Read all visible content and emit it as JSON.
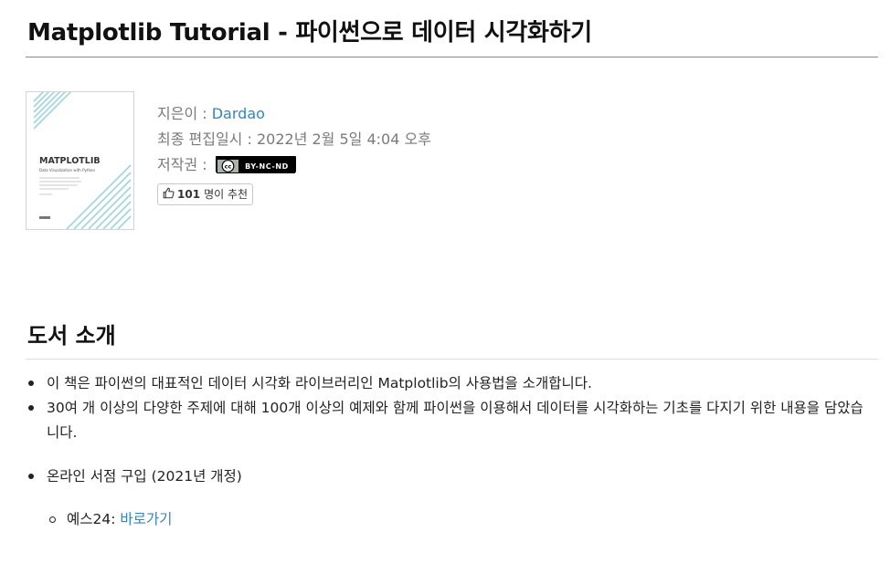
{
  "page": {
    "title": "Matplotlib Tutorial - 파이썬으로 데이터 시각화하기"
  },
  "book": {
    "cover_logo": "MATPLOTLIB",
    "cover_subtitle": "Data Visualization with Python",
    "author_label": "지은이 : ",
    "author_name": "Dardao",
    "updated_label": "최종 편집일시 : ",
    "updated_value": "2022년 2월 5일 4:04 오후",
    "license_label": "저작권 : ",
    "license_badge_cc": "cc",
    "license_badge_terms": "BY-NC-ND",
    "like_count": "101",
    "like_suffix": "명이 추천"
  },
  "intro": {
    "heading": "도서 소개",
    "bullets": [
      "이 책은 파이썬의 대표적인 데이터 시각화 라이브러리인 Matplotlib의 사용법을 소개합니다.",
      "30여 개 이상의 다양한 주제에 대해 100개 이상의 예제와 함께 파이썬을 이용해서 데이터를 시각화하는 기초를 다지기 위한 내용을 담았습니다."
    ],
    "purchase": {
      "label": "온라인 서점 구입 (2021년 개정)",
      "store_label": "예스24: ",
      "store_link": "바로가기"
    }
  },
  "colors": {
    "link": "#2f86c9",
    "cover_stripe": "#9ed5db",
    "meta_text": "#7a7a7a"
  }
}
